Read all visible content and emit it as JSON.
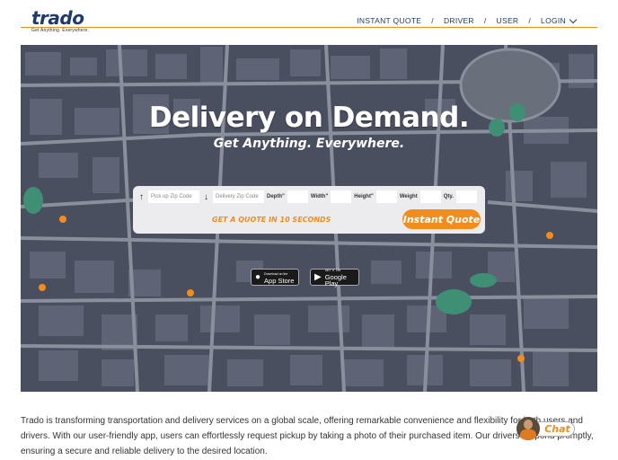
{
  "brand": {
    "name": "trado",
    "tagline": "Get Anything. Everywhere."
  },
  "nav": {
    "items": [
      "INSTANT QUOTE",
      "DRIVER",
      "USER",
      "LOGIN"
    ],
    "separator": "/"
  },
  "hero": {
    "title": "Delivery on Demand.",
    "subtitle": "Get Anything. Everywhere."
  },
  "quote_form": {
    "pickup_placeholder": "Pick up Zip Code",
    "delivery_placeholder": "Delivery Zip Code",
    "depth_label": "Depth\"",
    "width_label": "Width\"",
    "height_label": "Height\"",
    "weight_label": "Weight",
    "qty_label": "Qty.",
    "cta_text": "GET A QUOTE IN 10 SECONDS",
    "button_label": "Instant Quote"
  },
  "stores": {
    "apple_small": "Download on the",
    "apple_big": "App Store",
    "google_small": "GET IT ON",
    "google_big": "Google Play"
  },
  "description": "Trado is transforming transportation and delivery services on a global scale, offering remarkable convenience and flexibility for both users and drivers. With our user-friendly app, users can effortlessly request pickup by taking a photo of their purchased item. Our drivers respond promptly, ensuring a secure and reliable delivery to the desired location.",
  "chat": {
    "label": "Chat"
  },
  "colors": {
    "accent": "#f28c1c",
    "brand": "#1f3a6b",
    "map_bg": "#4a4f60"
  }
}
